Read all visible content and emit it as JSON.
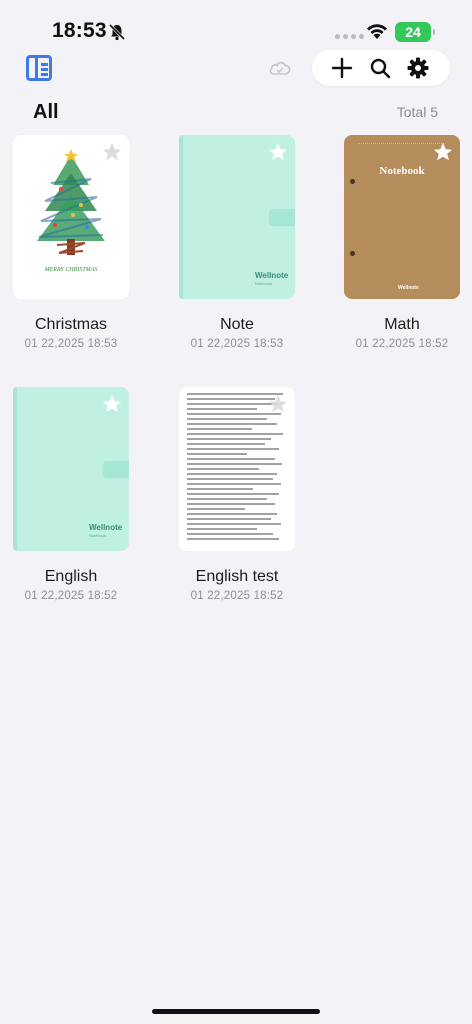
{
  "status_bar": {
    "time": "18:53",
    "battery": "24"
  },
  "header": {
    "section_title": "All",
    "total_label": "Total 5"
  },
  "toolbar": {
    "icons": [
      "sidebar-icon",
      "cloud-icon",
      "plus-icon",
      "search-icon",
      "gear-icon"
    ]
  },
  "notebooks": [
    {
      "title": "Christmas",
      "date": "01 22,2025 18:53",
      "cover": "christmas-tree",
      "cover_text": "MERRY CHRISTMAS"
    },
    {
      "title": "Note",
      "date": "01 22,2025 18:53",
      "cover": "mint",
      "brand": "Wellnote",
      "brand_sub": "Notebook"
    },
    {
      "title": "Math",
      "date": "01 22,2025 18:52",
      "cover": "kraft",
      "cover_title": "Notebook",
      "brand": "Wellnote"
    },
    {
      "title": "English",
      "date": "01 22,2025 18:52",
      "cover": "mint",
      "brand": "Wellnote",
      "brand_sub": "Notebook"
    },
    {
      "title": "English test",
      "date": "01 22,2025 18:52",
      "cover": "document"
    }
  ],
  "colors": {
    "accent": "#3e7be8",
    "background": "#f2f2f7",
    "battery": "#34c759",
    "mint_cover": "#bff0e2",
    "kraft_cover": "#b58c5c"
  }
}
